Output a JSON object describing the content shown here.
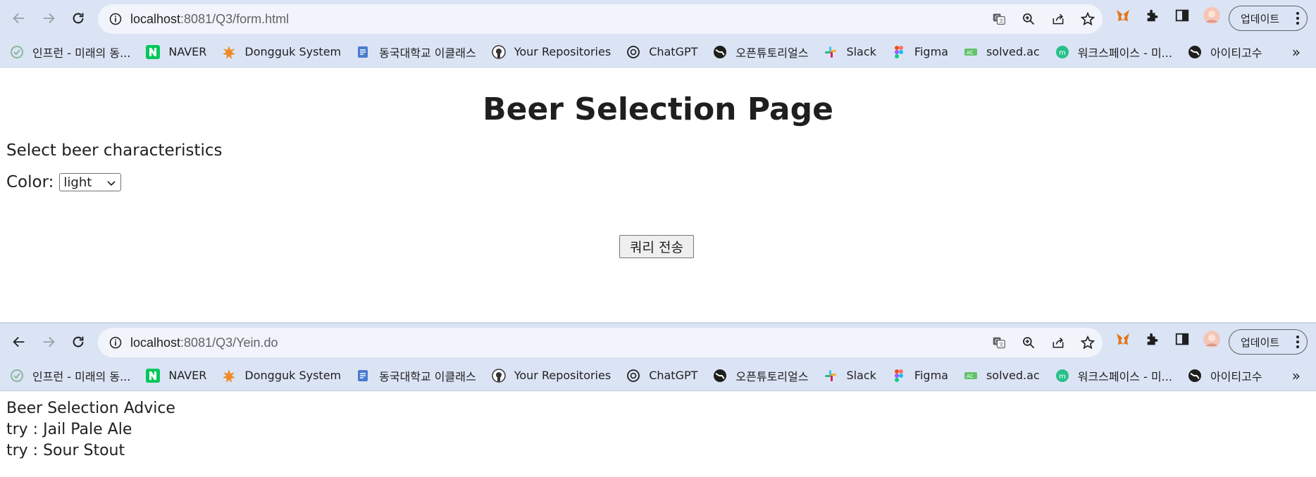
{
  "window1": {
    "url_host": "localhost",
    "url_rest": ":8081/Q3/form.html",
    "update_label": "업데이트",
    "page": {
      "title": "Beer Selection Page",
      "instruction": "Select beer characteristics",
      "color_label": "Color:",
      "color_selected": "light",
      "submit_label": "쿼리 전송"
    }
  },
  "window2": {
    "url_host": "localhost",
    "url_rest": ":8081/Q3/Yein.do",
    "update_label": "업데이트",
    "page": {
      "heading": "Beer Selection Advice",
      "results": [
        "try : Jail Pale Ale",
        "try : Sour Stout"
      ]
    }
  },
  "bookmarks": [
    {
      "label": "인프런 - 미래의 동...",
      "icon": "inflearn-icon",
      "color": "#00c471"
    },
    {
      "label": "NAVER",
      "icon": "naver-icon",
      "color": "#03c75a"
    },
    {
      "label": "Dongguk System",
      "icon": "dongguk-icon",
      "color": "#f08a24"
    },
    {
      "label": "동국대학교 이클래스",
      "icon": "eclass-icon",
      "color": "#4a7bd0"
    },
    {
      "label": "Your Repositories",
      "icon": "github-icon",
      "color": "#333333"
    },
    {
      "label": "ChatGPT",
      "icon": "chatgpt-icon",
      "color": "#1f1f1f"
    },
    {
      "label": "오픈튜토리얼스",
      "icon": "globe-icon",
      "color": "#1f1f1f"
    },
    {
      "label": "Slack",
      "icon": "slack-icon",
      "color": "#e01e5a"
    },
    {
      "label": "Figma",
      "icon": "figma-icon",
      "color": "#f24e1e"
    },
    {
      "label": "solved.ac",
      "icon": "solvedac-icon",
      "color": "#63c36b"
    },
    {
      "label": "워크스페이스 - 미...",
      "icon": "workspace-icon",
      "color": "#27c08a"
    },
    {
      "label": "아이티고수",
      "icon": "globe-icon",
      "color": "#1f1f1f"
    }
  ],
  "colors": {
    "chrome_bg": "#dbe4f5",
    "omnibox_bg": "#f1f4fa"
  }
}
